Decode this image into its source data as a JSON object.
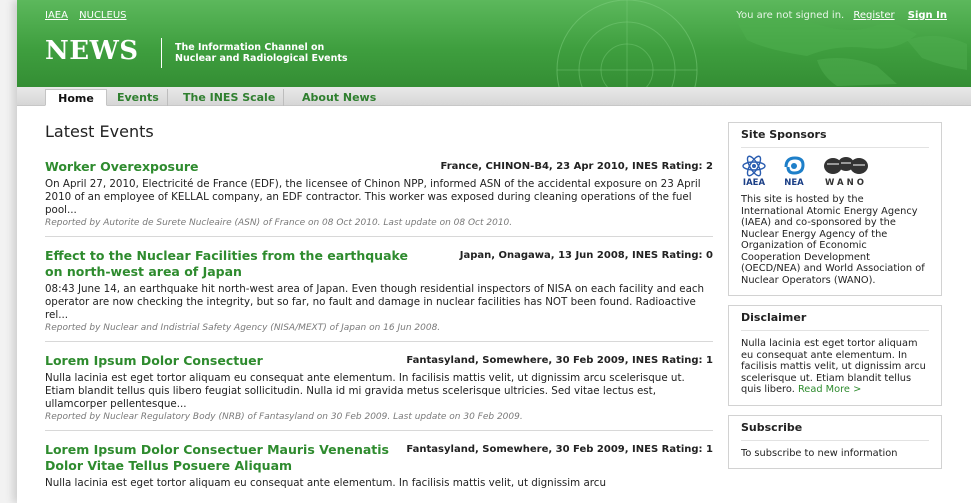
{
  "header": {
    "links": [
      "IAEA",
      "NUCLEUS"
    ],
    "account_text": "You are not signed in.",
    "register_label": "Register",
    "signin_label": "Sign In",
    "logo_text": "NEWS",
    "tagline_line1": "The Information Channel on",
    "tagline_line2": "Nuclear and Radiological Events"
  },
  "nav": {
    "tabs": [
      "Home",
      "Events",
      "The INES Scale",
      "About News"
    ],
    "active_tab": "Home"
  },
  "main": {
    "title": "Latest Events",
    "events": [
      {
        "title": "Worker Overexposure",
        "meta": "France, CHINON-B4, 23 Apr 2010, INES Rating: 2",
        "summary": "On April 27, 2010, Electricité de France (EDF), the licensee of Chinon NPP, informed ASN of the accidental exposure on 23 April 2010 of an employee of KELLAL company, an EDF contractor. This worker was exposed during cleaning operations of the fuel pool...",
        "reported": "Reported by Autorite de Surete Nucleaire (ASN) of France on 08 Oct 2010. Last update on 08 Oct 2010."
      },
      {
        "title": "Effect to the Nuclear Facilities from the earthquake on north-west area of Japan",
        "meta": "Japan, Onagawa, 13 Jun 2008, INES Rating: 0",
        "summary": "08:43 June 14, an earthquake hit north-west area of Japan. Even though residential inspectors of NISA on each facility and each operator are now checking the integrity, but so far, no fault and damage in nuclear facilities has NOT been found. Radioactive rel...",
        "reported": "Reported by Nuclear and Indistrial Safety Agency (NISA/MEXT) of Japan on 16 Jun 2008."
      },
      {
        "title": "Lorem Ipsum Dolor Consectuer",
        "meta": "Fantasyland, Somewhere, 30 Feb 2009, INES Rating: 1",
        "summary": "Nulla lacinia est eget tortor aliquam eu consequat ante elementum. In facilisis mattis velit, ut dignissim arcu scelerisque ut. Etiam blandit tellus quis libero feugiat sollicitudin. Nulla id mi gravida metus scelerisque ultricies. Sed vitae lectus est, ullamcorper pellentesque...",
        "reported": "Reported by Nuclear Regulatory Body (NRB) of Fantasyland on 30 Feb 2009. Last update on 30 Feb 2009."
      },
      {
        "title": "Lorem Ipsum Dolor Consectuer Mauris Venenatis Dolor Vitae Tellus Posuere Aliquam",
        "meta": "Fantasyland, Somewhere, 30 Feb 2009, INES Rating: 1",
        "summary": "Nulla lacinia est eget tortor aliquam eu consequat ante elementum. In facilisis mattis velit, ut dignissim arcu",
        "reported": ""
      }
    ]
  },
  "sidebar": {
    "sponsors": {
      "title": "Site Sponsors",
      "logo_labels": [
        "IAEA",
        "NEA",
        "WANO"
      ],
      "text": "This site is hosted by the International Atomic Energy Agency (IAEA) and co-sponsored by the Nuclear Energy Agency of the Organization of Economic Cooperation Development (OECD/NEA) and World Association of Nuclear Operators (WANO)."
    },
    "disclaimer": {
      "title": "Disclaimer",
      "text": "Nulla lacinia est eget tortor aliquam eu consequat ante elementum. In facilisis mattis velit, ut dignissim arcu scelerisque ut. Etiam blandit tellus quis libero.",
      "read_more": "Read More >"
    },
    "subscribe": {
      "title": "Subscribe",
      "text": "To subscribe to new information"
    }
  },
  "colors": {
    "header_green": "#3f9f3f",
    "link_green": "#2e8b2e",
    "nav_grey": "#dedede"
  }
}
